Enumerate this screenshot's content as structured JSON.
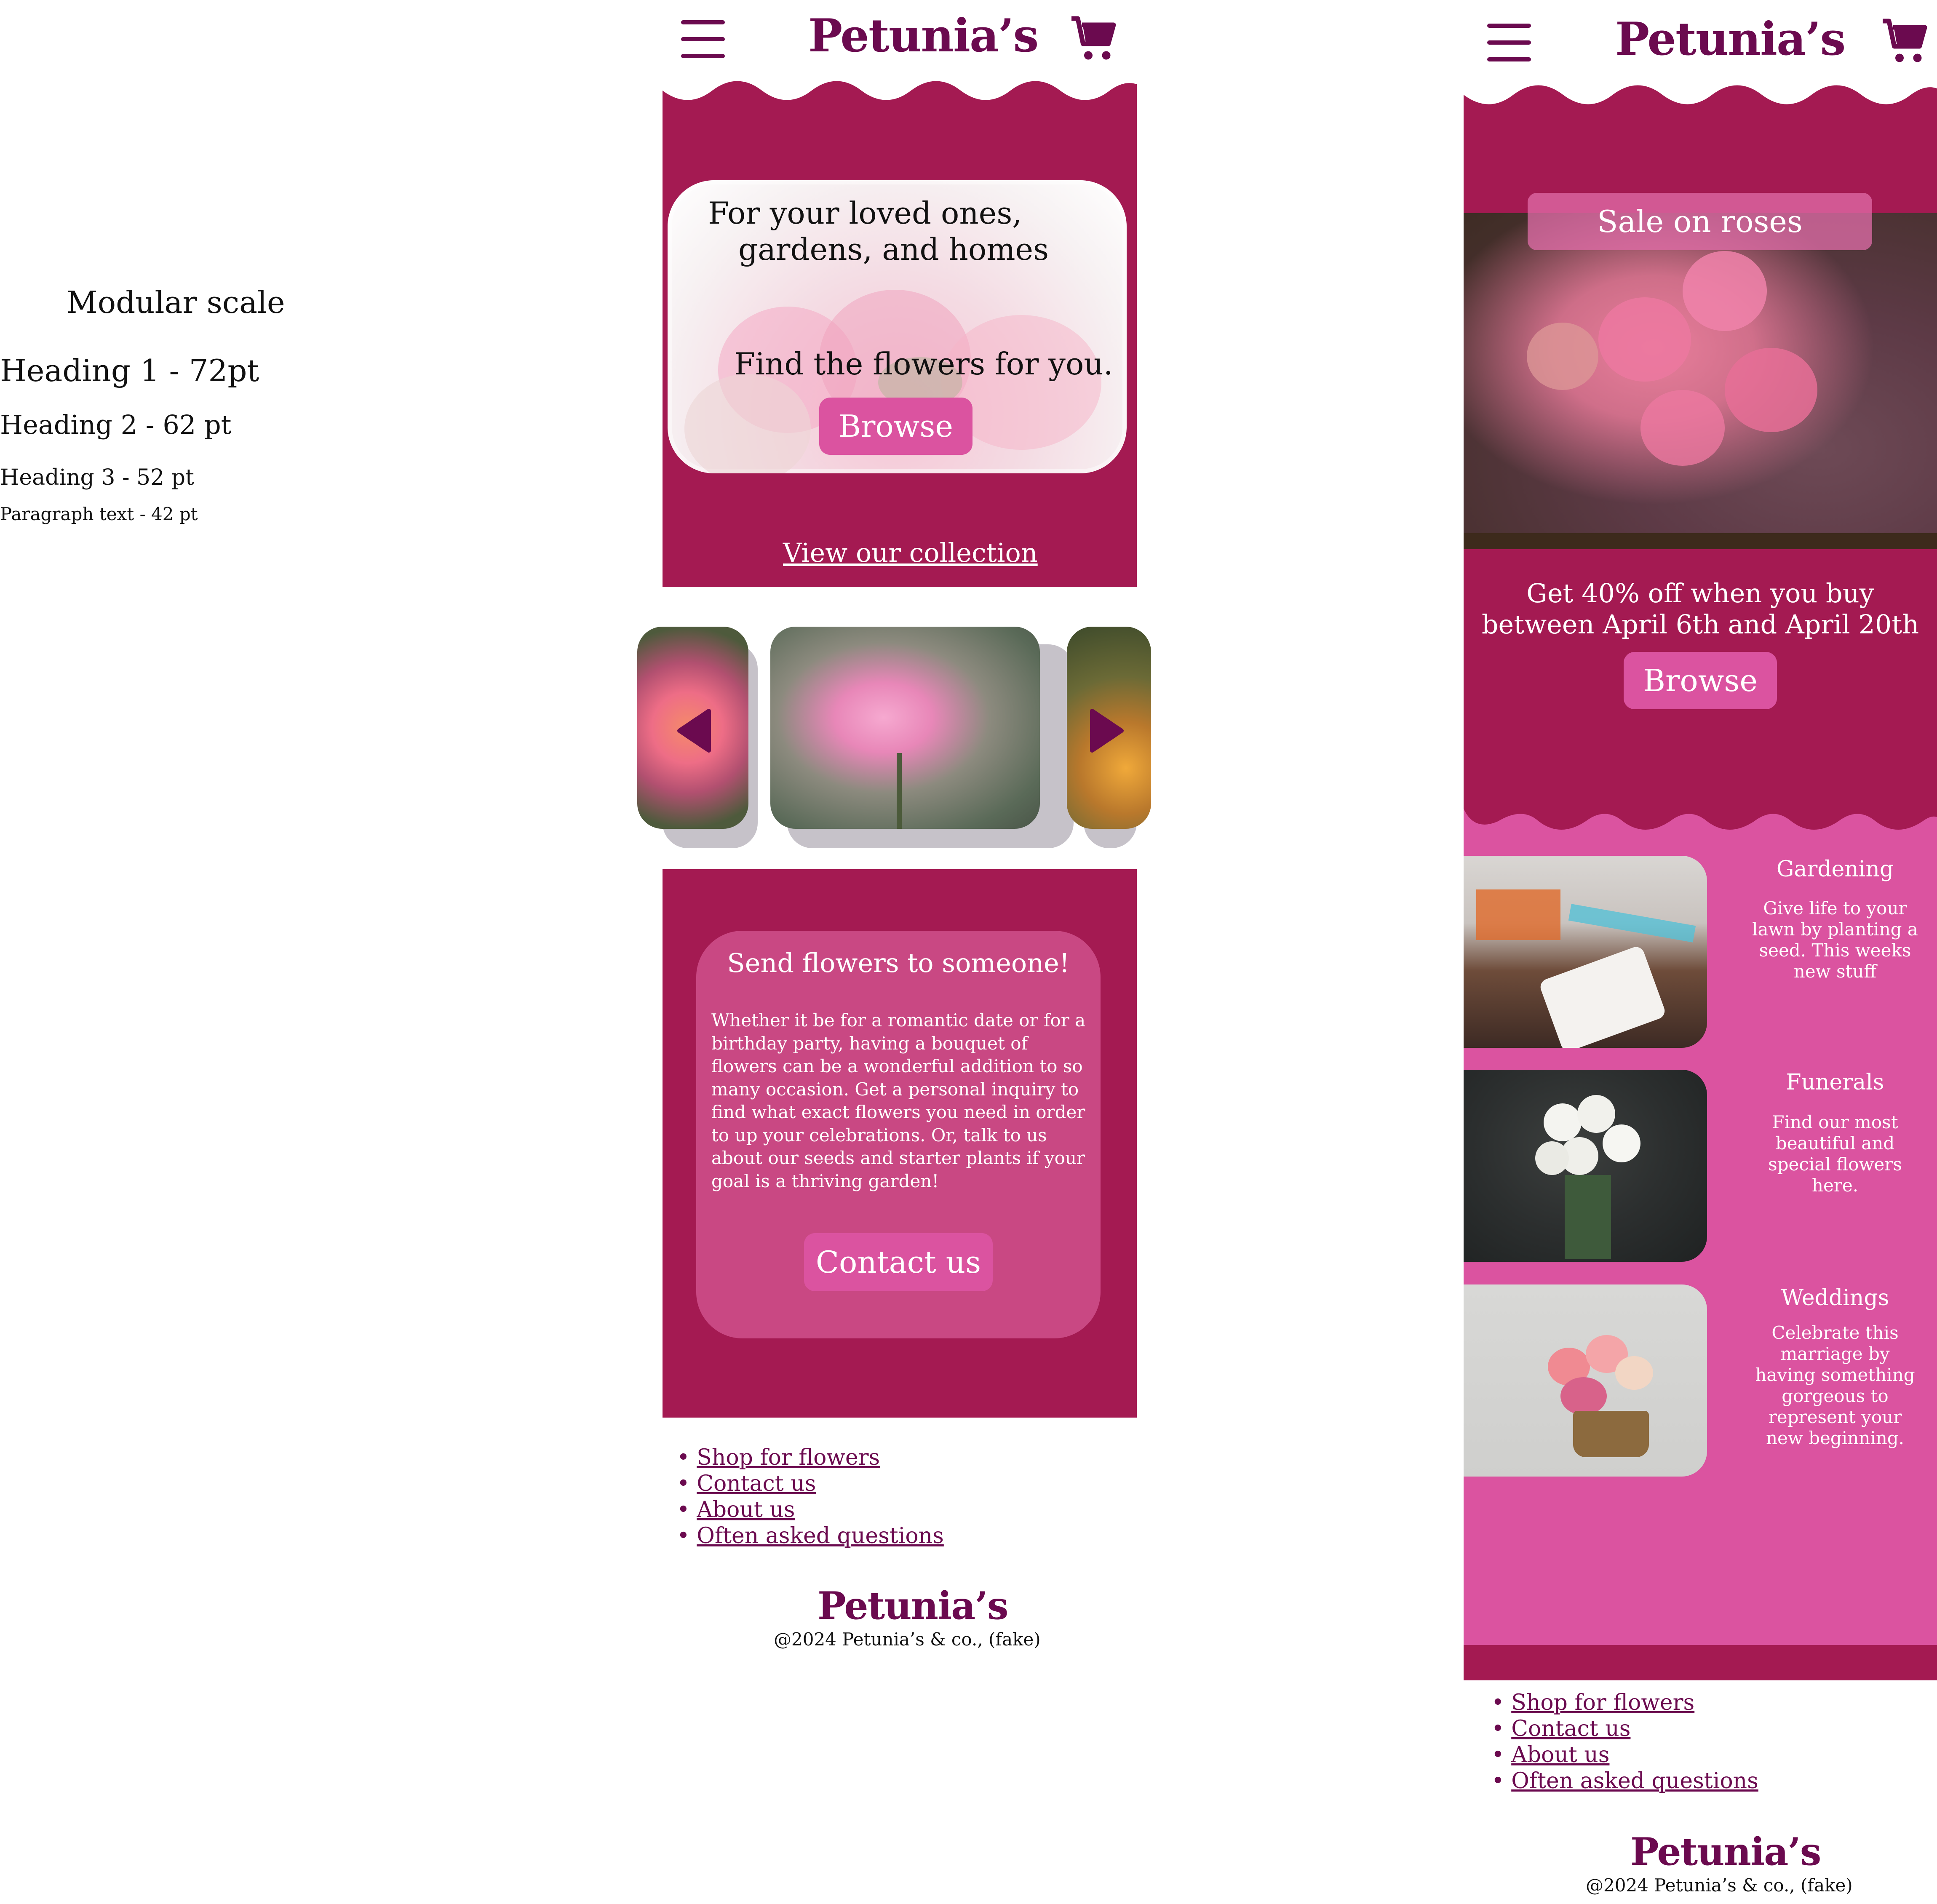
{
  "modular_scale": {
    "title": "Modular scale",
    "h1": "Heading 1 - 72pt",
    "h2": "Heading 2 - 62 pt",
    "h3": "Heading 3 - 52 pt",
    "p": "Paragraph text - 42 pt"
  },
  "brand": {
    "logo": "Petunia’s",
    "primary_color": "#a41a52",
    "accent_color": "#db53a0",
    "brand_text_color": "#6b0a4f",
    "menu_icon": "hamburger-menu-icon",
    "cart_icon": "shopping-cart-icon"
  },
  "page1": {
    "hero": {
      "line1": "For your loved ones,",
      "line2": "gardens, and homes",
      "line3": "Find the flowers for you.",
      "button": "Browse",
      "link": "View our collection"
    },
    "carousel": {
      "prev_icon": "carousel-prev-arrow-icon",
      "next_icon": "carousel-next-arrow-icon"
    },
    "send": {
      "title": "Send flowers to someone!",
      "body": "Whether it be for a romantic date or for a birthday party, having a bouquet of flowers can be a wonderful addition to so many occasion. Get a personal inquiry to find what exact flowers you need in order to up your celebrations. Or, talk to us about our seeds and starter plants if your goal is a thriving garden!",
      "button": "Contact us"
    }
  },
  "page2": {
    "sale": {
      "badge": "Sale on roses",
      "text": "Get 40% off when you buy between April 6th and April 20th",
      "button": "Browse"
    },
    "categories": [
      {
        "title": "Gardening",
        "text": "Give life to your lawn by planting a seed. This weeks new stuff"
      },
      {
        "title": "Funerals",
        "text": "Find our most beautiful and special flowers here."
      },
      {
        "title": "Weddings",
        "text": "Celebrate this marriage by having something gorgeous to represent your new beginning."
      }
    ]
  },
  "footer": {
    "links": [
      "Shop for flowers",
      "Contact us",
      "About us",
      "Often asked questions"
    ],
    "logo": "Petunia’s",
    "copyright": "@2024 Petunia’s & co., (fake)"
  }
}
